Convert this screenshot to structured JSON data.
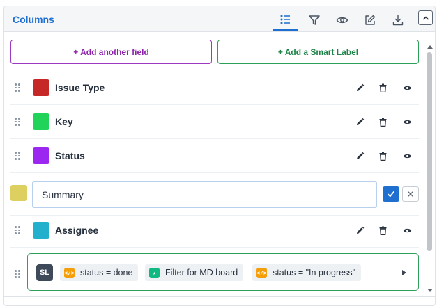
{
  "header": {
    "title": "Columns",
    "tools": [
      "list-icon",
      "filter-icon",
      "eye-icon",
      "edit-icon",
      "download-icon"
    ],
    "active_tool": "list-icon",
    "accent": "#1f6fd0"
  },
  "actions": {
    "add_field": "+ Add another field",
    "add_smart_label": "+ Add a Smart Label"
  },
  "fields": [
    {
      "label": "Issue Type",
      "color": "#c62828"
    },
    {
      "label": "Key",
      "color": "#22d35a"
    },
    {
      "label": "Status",
      "color": "#9c27f0"
    }
  ],
  "editing_field": {
    "value": "Summary",
    "color": "#ddd060"
  },
  "fields_after": [
    {
      "label": "Assignee",
      "color": "#22b0cc"
    }
  ],
  "smart_label": {
    "badge": "SL",
    "chips": [
      {
        "text": "status = done",
        "icon": "code-icon",
        "icon_color": "#f59e0b"
      },
      {
        "text": "Filter for MD board",
        "icon": "star-icon",
        "icon_color": "#10b981"
      },
      {
        "text": "status = \"In progress\"",
        "icon": "code-icon",
        "icon_color": "#f59e0b"
      }
    ]
  }
}
